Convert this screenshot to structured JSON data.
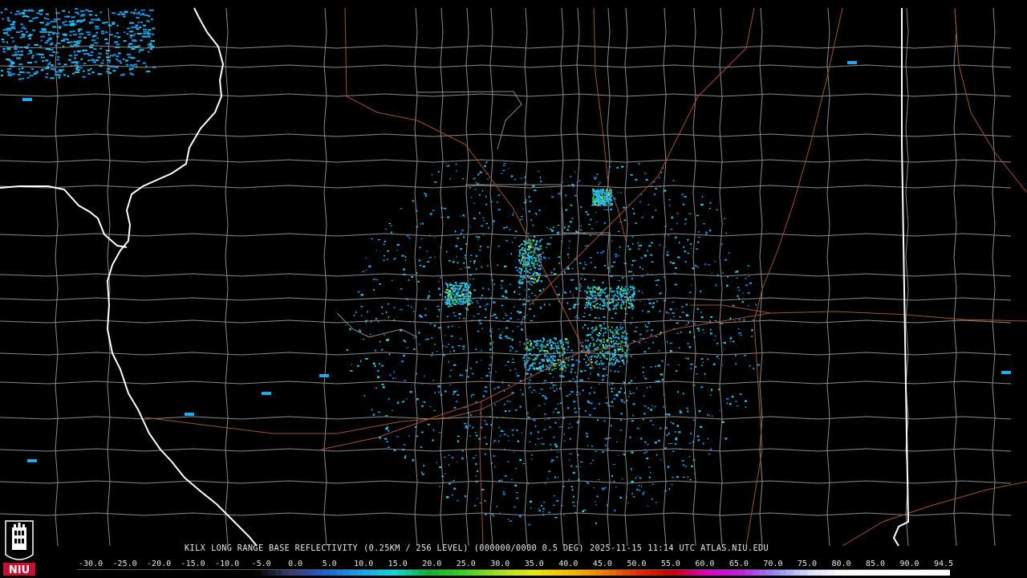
{
  "product": {
    "station": "KILX",
    "name": "LONG RANGE BASE REFLECTIVITY",
    "resolution": "(0.25KM / 256 LEVEL)",
    "code": "(000000/0000 0.5 DEG)",
    "date": "2025-11-15",
    "time": "11:14 UTC",
    "site": "ATLAS.NIU.EDU"
  },
  "logo": {
    "text": "NIU",
    "colors": {
      "red": "#c8102e",
      "black": "#000000",
      "white": "#ffffff"
    }
  },
  "scale": {
    "labels": [
      "-30.0",
      "-25.0",
      "-20.0",
      "-15.0",
      "-10.0",
      "-5.0",
      "0.0",
      "5.0",
      "10.0",
      "15.0",
      "20.0",
      "25.0",
      "30.0",
      "35.0",
      "40.0",
      "45.0",
      "50.0",
      "55.0",
      "60.0",
      "65.0",
      "70.0",
      "75.0",
      "80.0",
      "85.0",
      "90.0",
      "94.5"
    ],
    "min": -30,
    "max": 94.5
  },
  "colors": {
    "background": "#000000",
    "county_lines": "#8a8a8a",
    "state_lines": "#ffffff",
    "roads": "#a0522d",
    "echo_light": "#2aa8e8",
    "echo_mid": "#20e0e0",
    "echo_strong": "#18c818",
    "echo_peak": "#ffff00"
  }
}
